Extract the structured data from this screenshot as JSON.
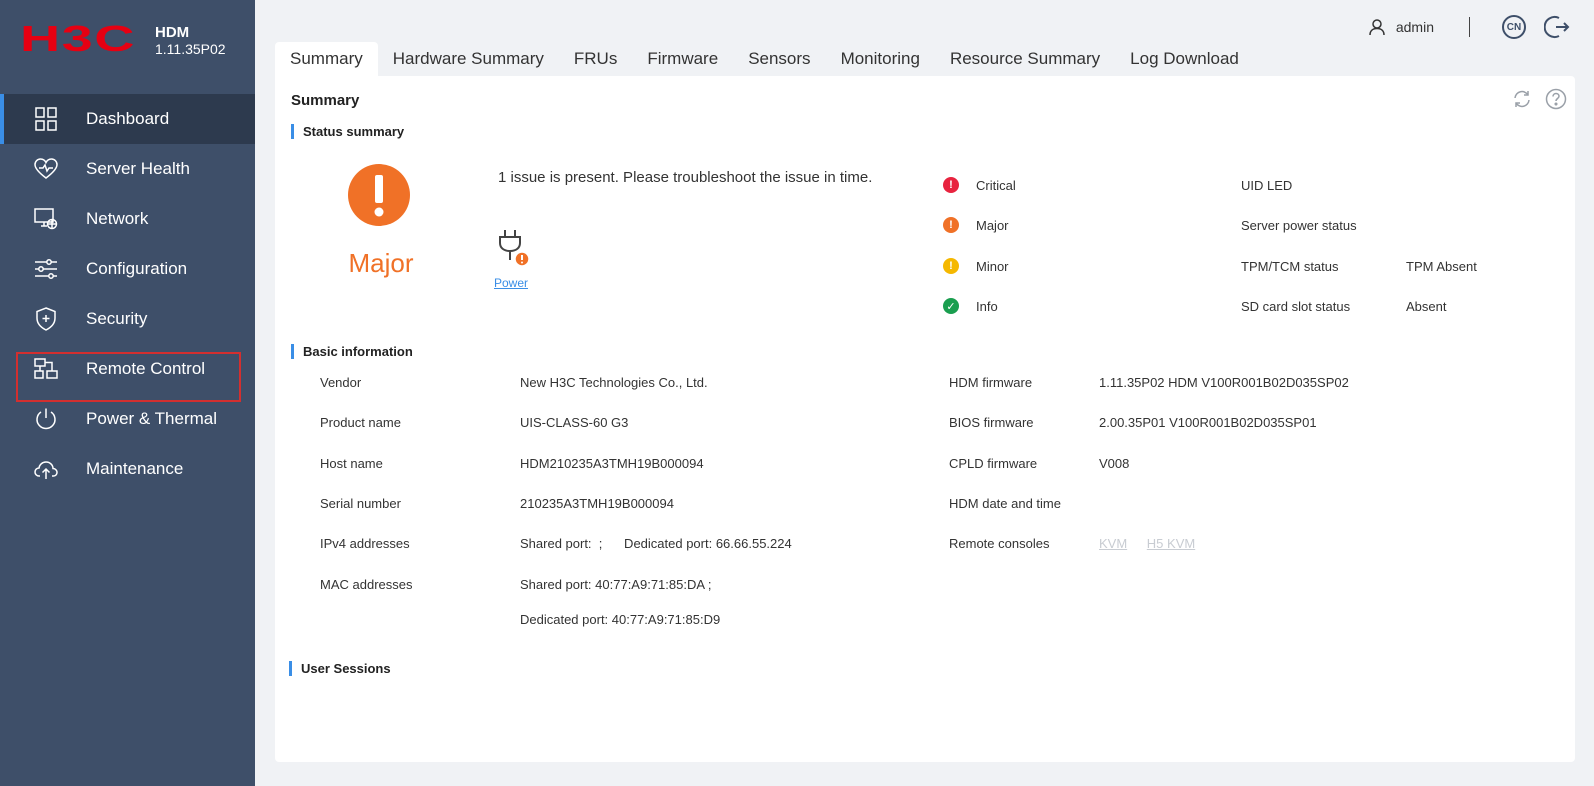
{
  "sidebar": {
    "logo_text": "H3C",
    "product": "HDM",
    "version": "1.11.35P02",
    "items": [
      {
        "label": "Dashboard",
        "icon": "grid-icon"
      },
      {
        "label": "Server Health",
        "icon": "heart-icon"
      },
      {
        "label": "Network",
        "icon": "network-icon"
      },
      {
        "label": "Configuration",
        "icon": "sliders-icon"
      },
      {
        "label": "Security",
        "icon": "shield-icon"
      },
      {
        "label": "Remote Control",
        "icon": "remote-icon"
      },
      {
        "label": "Power & Thermal",
        "icon": "power-icon"
      },
      {
        "label": "Maintenance",
        "icon": "cloud-upload-icon"
      }
    ]
  },
  "header": {
    "username": "admin",
    "lang": "CN"
  },
  "tabs": [
    "Summary",
    "Hardware Summary",
    "FRUs",
    "Firmware",
    "Sensors",
    "Monitoring",
    "Resource Summary",
    "Log Download"
  ],
  "summary": {
    "title": "Summary",
    "status_section": "Status summary",
    "overall_status": "Major",
    "issue_text": "1 issue is present. Please troubleshoot the issue in time.",
    "power_link": "Power",
    "severities": [
      {
        "label": "Critical",
        "color": "#e8233f",
        "glyph": "!"
      },
      {
        "label": "Major",
        "color": "#f07127",
        "glyph": "!"
      },
      {
        "label": "Minor",
        "color": "#f5b800",
        "glyph": "!"
      },
      {
        "label": "Info",
        "color": "#1a9e4f",
        "glyph": "✓"
      }
    ],
    "status_items": [
      {
        "label": "UID LED",
        "value": ""
      },
      {
        "label": "Server power status",
        "value": ""
      },
      {
        "label": "TPM/TCM status",
        "value": "TPM Absent"
      },
      {
        "label": "SD card slot status",
        "value": "Absent"
      }
    ],
    "basic_section": "Basic information",
    "basic_left": [
      {
        "label": "Vendor",
        "value": "New H3C Technologies Co., Ltd."
      },
      {
        "label": "Product name",
        "value": "UIS-CLASS-60 G3"
      },
      {
        "label": "Host name",
        "value": "HDM210235A3TMH19B000094"
      },
      {
        "label": "Serial number",
        "value": "210235A3TMH19B000094"
      },
      {
        "label": "IPv4 addresses",
        "value": "Shared port:  ;      Dedicated port: 66.66.55.224"
      },
      {
        "label": "MAC addresses",
        "value": "Shared port: 40:77:A9:71:85:DA ;"
      }
    ],
    "mac_dedicated": "Dedicated port: 40:77:A9:71:85:D9",
    "basic_right": [
      {
        "label": "HDM firmware",
        "value": "1.11.35P02 HDM V100R001B02D035SP02"
      },
      {
        "label": "BIOS firmware",
        "value": "2.00.35P01 V100R001B02D035SP01"
      },
      {
        "label": "CPLD firmware",
        "value": "V008"
      },
      {
        "label": "HDM date and time",
        "value": ""
      },
      {
        "label": "Remote consoles",
        "value": ""
      }
    ],
    "consoles": [
      "KVM",
      "H5 KVM"
    ],
    "sessions_section": "User Sessions"
  },
  "colors": {
    "sidebar_bg": "#3e4f69",
    "sidebar_active": "#2d3a4e",
    "accent": "#3a8ee6",
    "major": "#f07127",
    "logo_red": "#e60012"
  }
}
